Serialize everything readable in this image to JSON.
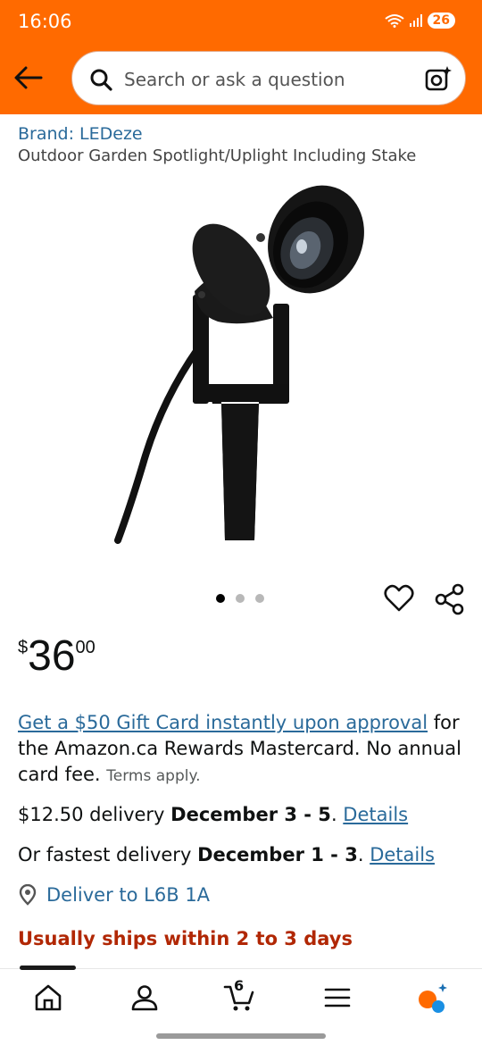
{
  "status_bar": {
    "time": "16:06",
    "battery": "26"
  },
  "search": {
    "placeholder": "Search or ask a question"
  },
  "product": {
    "brand": "Brand: LEDeze",
    "title": "Outdoor Garden Spotlight/Uplight Including Stake",
    "image_count": 3,
    "active_image": 1
  },
  "price": {
    "symbol": "$",
    "whole": "36",
    "fraction": "00"
  },
  "promo": {
    "link_text": "Get a $50 Gift Card instantly upon approval",
    "text": " for the Amazon.ca Rewards Mastercard. No annual card fee. ",
    "terms": "Terms apply."
  },
  "delivery": {
    "standard_prefix": "$12.50 delivery ",
    "standard_dates": "December 3 - 5",
    "fast_prefix": "Or fastest delivery ",
    "fast_dates": "December 1 - 3",
    "period": ". ",
    "details_label": "Details",
    "deliver_to": "Deliver to  L6B 1A",
    "ships": "Usually ships within 2 to 3 days"
  },
  "nav": {
    "cart_count": "6"
  },
  "colors": {
    "header": "#ff6a00",
    "link": "#2a6a9a",
    "alert": "#b12704"
  },
  "icons": [
    "back-arrow-icon",
    "search-icon",
    "camera-icon",
    "heart-icon",
    "share-icon",
    "location-pin-icon",
    "home-icon",
    "account-icon",
    "cart-icon",
    "menu-icon",
    "rufus-icon"
  ]
}
